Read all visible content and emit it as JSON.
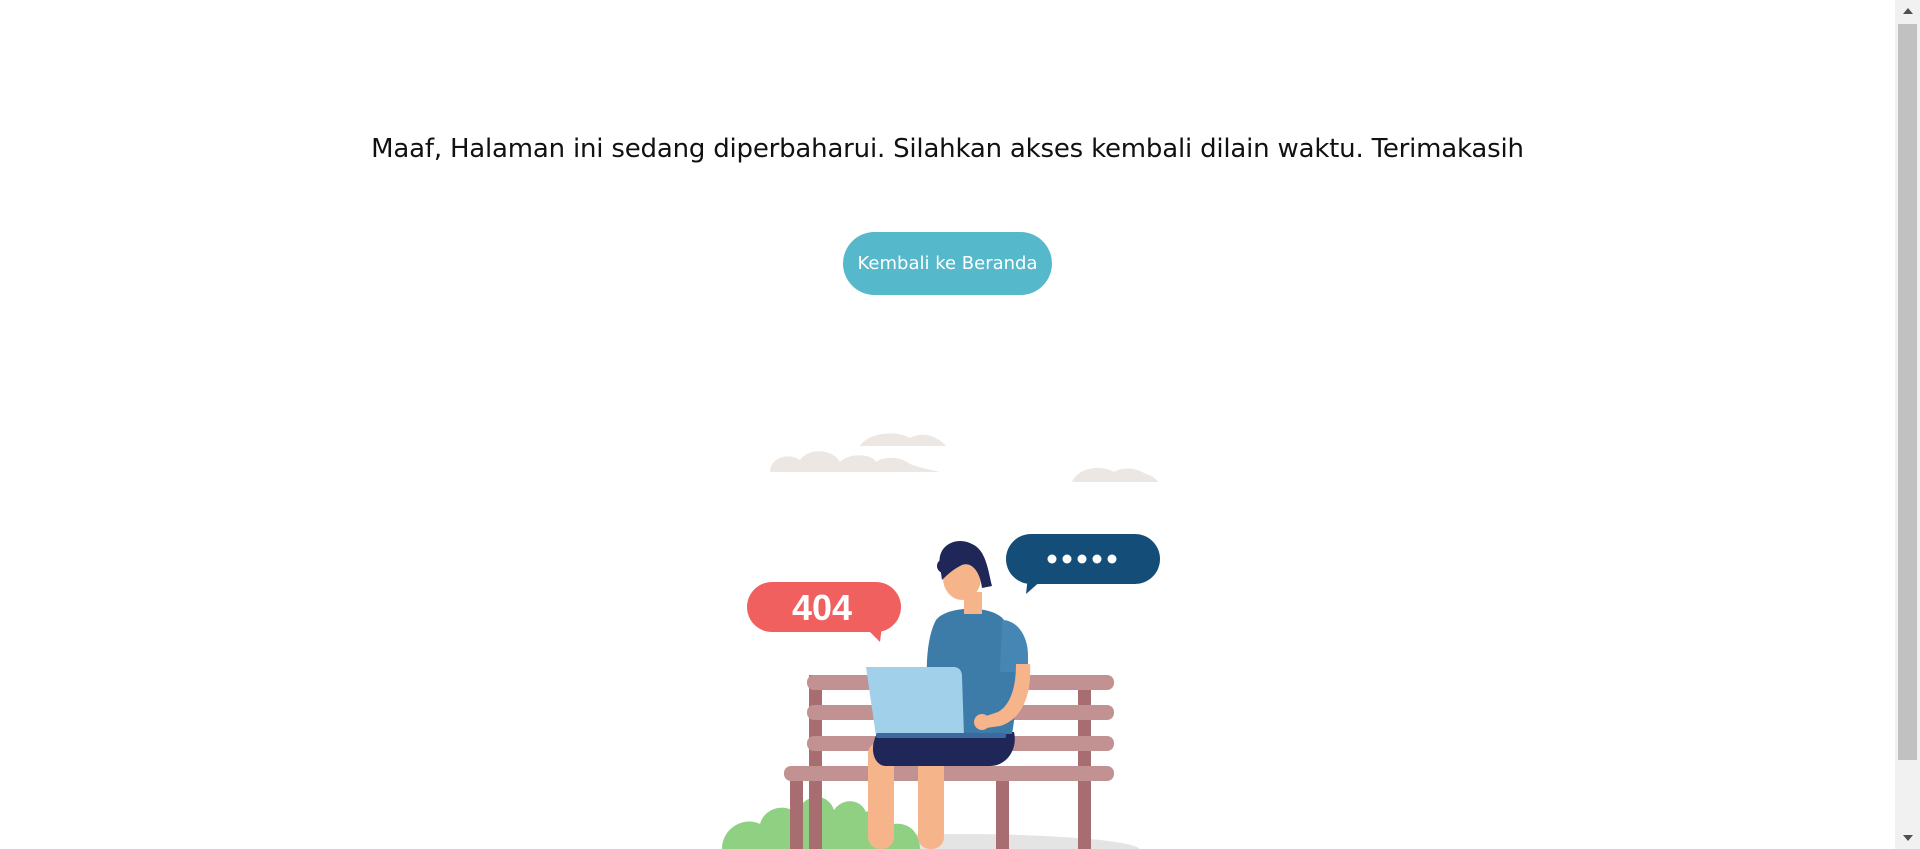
{
  "message": "Maaf, Halaman ini sedang diperbaharui. Silahkan akses kembali dilain waktu. Terimakasih",
  "home_button": {
    "label": "Kembali ke Beranda"
  },
  "illustration": {
    "error_code": "404",
    "colors": {
      "button": "#55b8cb",
      "bubble_error": "#f0605e",
      "bubble_dots": "#144e78",
      "bench": "#b88a8a",
      "shirt": "#3d7ba8",
      "laptop": "#a0d0ea",
      "cloud": "#ece7e3",
      "bush": "#8fd082"
    },
    "icons": [
      "cloud-icon",
      "speech-bubble-icon",
      "person-icon",
      "bench-icon",
      "laptop-icon",
      "bush-icon"
    ]
  }
}
